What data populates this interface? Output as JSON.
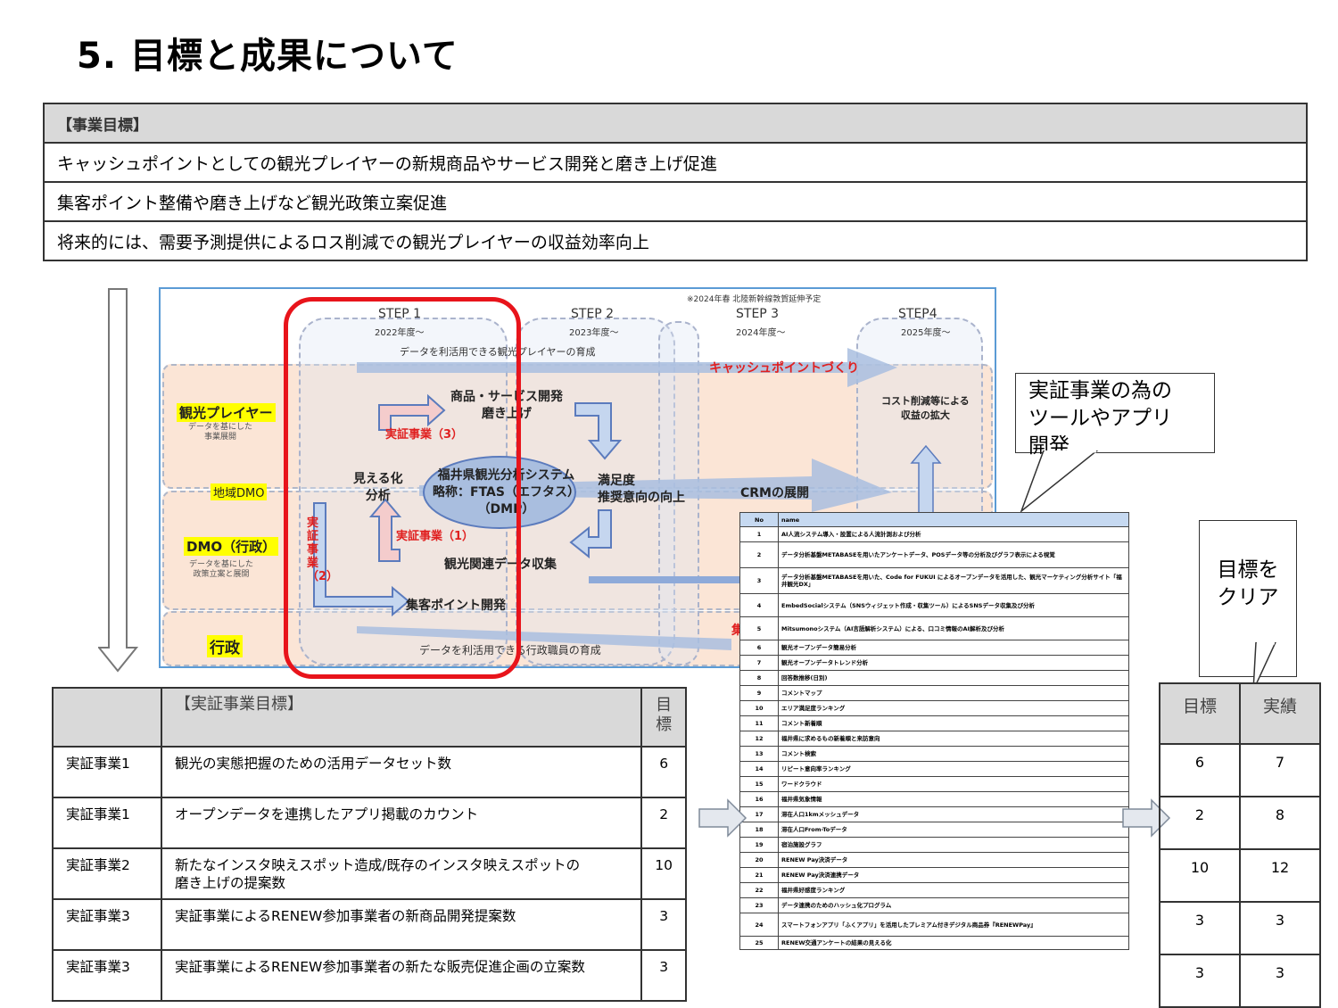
{
  "page_title": "5. 目標と成果について",
  "business_goals": {
    "header": "【事業目標】",
    "items": [
      "キャッシュポイントとしての観光プレイヤーの新規商品やサービス開発と磨き上げ促進",
      "集客ポイント整備や磨き上げなど観光政策立案促進",
      "将来的には、需要予測提供によるロス削減での観光プレイヤーの収益効率向上"
    ]
  },
  "diagram": {
    "note": "※2024年春 北陸新幹線敦賀延伸予定",
    "steps": [
      {
        "label": "STEP 1",
        "year": "2022年度～"
      },
      {
        "label": "STEP 2",
        "year": "2023年度～"
      },
      {
        "label": "STEP 3",
        "year": "2024年度～"
      },
      {
        "label": "STEP4",
        "year": "2025年度～"
      }
    ],
    "top_caption": "データを利活用できる観光プレイヤーの育成",
    "cash_point": "キャッシュポイントづくり",
    "rows": {
      "player": "観光プレイヤー",
      "player_sub": "データを基にした\n事業展開",
      "local_dmo": "地域DMO",
      "dmo": "DMO（行政）",
      "dmo_sub": "データを基にした\n政策立案と展開",
      "gov": "行政"
    },
    "product_dev": "商品・サービス開発\n磨き上げ",
    "demo3": "実証事業（3）",
    "visible": "見える化\n分析",
    "system": "福井県観光分析システム\n略称：FTAS（エフタス）\n（DMP）",
    "satisfaction": "満足度\n推奨意向の向上",
    "crm": "CRMの展開",
    "demo1": "実証事業（1）",
    "data_collect": "観光関連データ収集",
    "demo2": "実証事業（2）",
    "spot_dev": "集客ポイント開発",
    "cost": "コスト削減等による\n収益の拡大",
    "bottom_caption": "データを利活用できる行政職員の育成",
    "gov_red": "集"
  },
  "callout_tools": "実証事業の為の\nツールやアプリ\n開発",
  "callout_clear": "目標を\nクリア",
  "tool_list": {
    "headers": [
      "No",
      "name"
    ],
    "rows": [
      [
        "1",
        "AI人流システム導入・設置による人流計測および分析"
      ],
      [
        "2",
        "データ分析基盤METABASEを用いたアンケートデータ、POSデータ等の分析及びグラフ表示による視覚"
      ],
      [
        "3",
        "データ分析基盤METABASEを用いた、Code for FUKUI によるオープンデータを活用した、観光マーケティング分析サイト「福井観光DX」"
      ],
      [
        "4",
        "EmbedSocialシステム（SNSウィジェット作成・収集ツール）によるSNSデータ収集及び分析"
      ],
      [
        "5",
        "Mitsumonoシステム（AI言語解析システム）による、口コミ情報のAI解析及び分析"
      ],
      [
        "6",
        "観光オープンデータ簡易分析"
      ],
      [
        "7",
        "観光オープンデータトレンド分析"
      ],
      [
        "8",
        "回答数推移(日別)"
      ],
      [
        "9",
        "コメントマップ"
      ],
      [
        "10",
        "エリア満足度ランキング"
      ],
      [
        "11",
        "コメント新着順"
      ],
      [
        "12",
        "福井県に求めるもの新着順と来訪意向"
      ],
      [
        "13",
        "コメント検索"
      ],
      [
        "14",
        "リピート意向率ランキング"
      ],
      [
        "15",
        "ワードクラウド"
      ],
      [
        "16",
        "福井県気象情報"
      ],
      [
        "17",
        "滞在人口1kmメッシュデータ"
      ],
      [
        "18",
        "滞在人口From-Toデータ"
      ],
      [
        "19",
        "宿泊施設グラフ"
      ],
      [
        "20",
        "RENEW Pay決済データ"
      ],
      [
        "21",
        "RENEW Pay決済連携データ"
      ],
      [
        "22",
        "福井県好感度ランキング"
      ],
      [
        "23",
        "データ連携のためのハッシュ化プログラム"
      ],
      [
        "24",
        "スマートフォンアプリ「ふくアプリ」を活用したプレミアム付きデジタル商品券『RENEWPay』"
      ],
      [
        "25",
        "RENEW交通アンケートの結果の見える化"
      ]
    ]
  },
  "demo_goals": {
    "header": "【実証事業目標】",
    "target_header": "目\n標",
    "rows": [
      {
        "project": "実証事業1",
        "goal": "観光の実態把握のための活用データセット数",
        "target": "6"
      },
      {
        "project": "実証事業1",
        "goal": "オープンデータを連携したアプリ掲載のカウント",
        "target": "2"
      },
      {
        "project": "実証事業2",
        "goal": "新たなインスタ映えスポット造成/既存のインスタ映えスポットの\n磨き上げの提案数",
        "target": "10"
      },
      {
        "project": "実証事業3",
        "goal": "実証事業によるRENEW参加事業者の新商品開発提案数",
        "target": "3"
      },
      {
        "project": "実証事業3",
        "goal": "実証事業によるRENEW参加事業者の新たな販売促進企画の立案数",
        "target": "3"
      }
    ]
  },
  "results": {
    "headers": [
      "目標",
      "実績"
    ],
    "rows": [
      [
        "6",
        "7"
      ],
      [
        "2",
        "8"
      ],
      [
        "10",
        "12"
      ],
      [
        "3",
        "3"
      ],
      [
        "3",
        "3"
      ]
    ]
  }
}
